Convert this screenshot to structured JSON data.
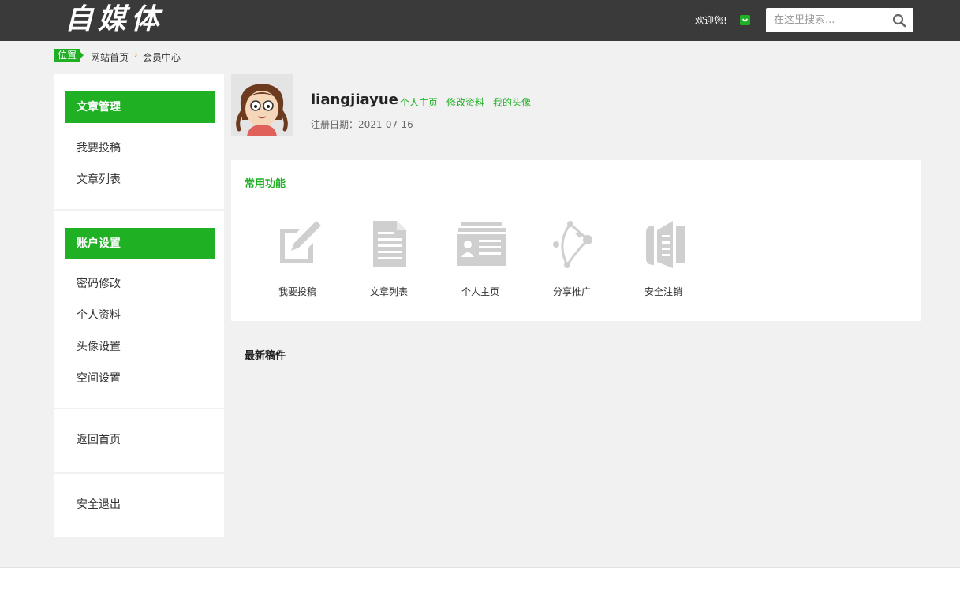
{
  "header": {
    "logo_text": "自媒体",
    "welcome": "欢迎您!",
    "search": {
      "placeholder": "在这里搜索..."
    }
  },
  "breadcrumb": {
    "tag": "位置",
    "home": "网站首页",
    "separator": "›",
    "current": "会员中心"
  },
  "sidebar": {
    "sections": [
      {
        "title": "文章管理",
        "items": [
          "我要投稿",
          "文章列表"
        ]
      },
      {
        "title": "账户设置",
        "items": [
          "密码修改",
          "个人资料",
          "头像设置",
          "空间设置"
        ]
      }
    ],
    "links": [
      "返回首页",
      "安全退出"
    ]
  },
  "profile": {
    "username": "liangjiayue",
    "links": [
      "个人主页",
      "修改资料",
      "我的头像"
    ],
    "reg_label": "注册日期：",
    "reg_date": "2021-07-16"
  },
  "functions": {
    "title": "常用功能",
    "items": [
      {
        "label": "我要投稿",
        "icon": "edit-icon"
      },
      {
        "label": "文章列表",
        "icon": "document-icon"
      },
      {
        "label": "个人主页",
        "icon": "id-card-icon"
      },
      {
        "label": "分享推广",
        "icon": "share-curve-icon"
      },
      {
        "label": "安全注销",
        "icon": "logout-door-icon"
      }
    ]
  },
  "latest": {
    "title": "最新稿件"
  },
  "colors": {
    "accent": "#1fb024",
    "topbar": "#3a3a3a",
    "icon_gray": "#cfcfcf"
  }
}
